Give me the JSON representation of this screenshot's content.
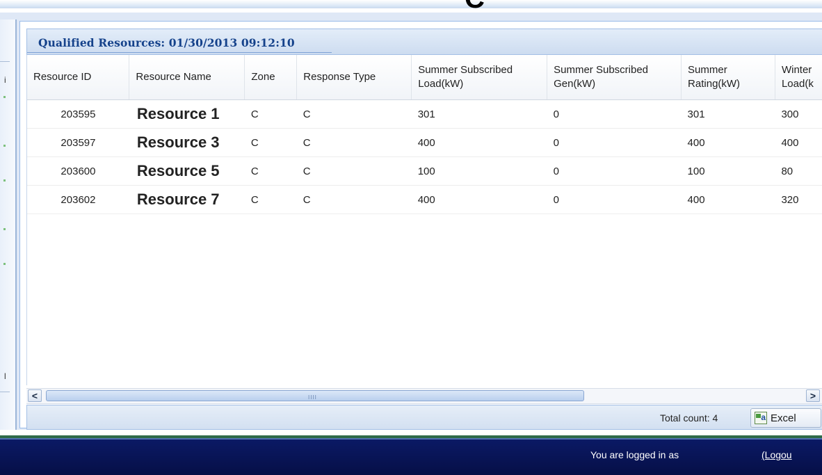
{
  "overlay_letter": "C",
  "left_sliver_chars": [
    "i",
    "l"
  ],
  "panel": {
    "title": "Qualified Resources: 01/30/2013 09:12:10"
  },
  "table": {
    "columns": [
      {
        "line1": "Resource ID",
        "line2": ""
      },
      {
        "line1": "Resource Name",
        "line2": ""
      },
      {
        "line1": "Zone",
        "line2": ""
      },
      {
        "line1": "Response Type",
        "line2": ""
      },
      {
        "line1": "Summer Subscribed",
        "line2": "Load(kW)"
      },
      {
        "line1": "Summer Subscribed",
        "line2": "Gen(kW)"
      },
      {
        "line1": "Summer",
        "line2": "Rating(kW)"
      },
      {
        "line1": "Winter",
        "line2": "Load(k"
      }
    ],
    "rows": [
      [
        "203595",
        "Resource 1",
        "C",
        "C",
        "301",
        "0",
        "301",
        "300"
      ],
      [
        "203597",
        "Resource 3",
        "C",
        "C",
        "400",
        "0",
        "400",
        "400"
      ],
      [
        "203600",
        "Resource 5",
        "C",
        "C",
        "100",
        "0",
        "100",
        "80"
      ],
      [
        "203602",
        "Resource 7",
        "C",
        "C",
        "400",
        "0",
        "400",
        "320"
      ]
    ]
  },
  "scrollbar": {
    "left_arrow": "<",
    "right_arrow": ">",
    "grip": "IIII"
  },
  "footer": {
    "total_count": "Total count: 4",
    "excel_label": "Excel",
    "excel_icon_glyph": "a"
  },
  "bottom_bar": {
    "logged_in_text": "You are logged in as",
    "logout_text": "(Logou"
  },
  "colors": {
    "title_text": "#15428b",
    "bottom_bar": "#0b1a66",
    "green_rule": "#2f6b49"
  },
  "icons": [
    "excel-icon",
    "scroll-left-arrow-icon",
    "scroll-right-arrow-icon"
  ]
}
